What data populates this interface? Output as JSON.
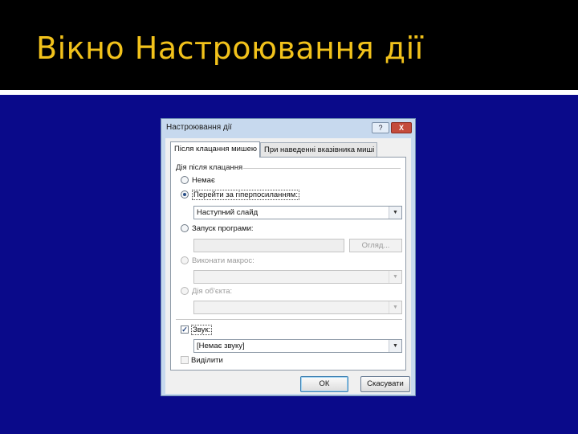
{
  "slide": {
    "title": "Вікно Настроювання дії"
  },
  "dialog": {
    "title": "Настроювання дії",
    "help_label": "?",
    "close_label": "X",
    "tabs": [
      {
        "label": "Після клацання мишею",
        "active": true
      },
      {
        "label": "При наведенні вказівника миші",
        "active": false
      }
    ],
    "group_label": "Дія після клацання",
    "options": {
      "none": "Немає",
      "hyperlink": "Перейти за гіперпосиланням:",
      "hyperlink_value": "Наступний слайд",
      "run_program": "Запуск програми:",
      "browse": "Огляд...",
      "run_macro": "Виконати макрос:",
      "object_action": "Дія об'єкта:"
    },
    "sound": {
      "label": "Звук:",
      "value": "[Немає звуку]",
      "checked": true
    },
    "highlight": {
      "label": "Виділити",
      "checked": false
    },
    "buttons": {
      "ok": "ОК",
      "cancel": "Скасувати"
    },
    "checkmark": "✓",
    "dropdown_arrow": "▼"
  }
}
